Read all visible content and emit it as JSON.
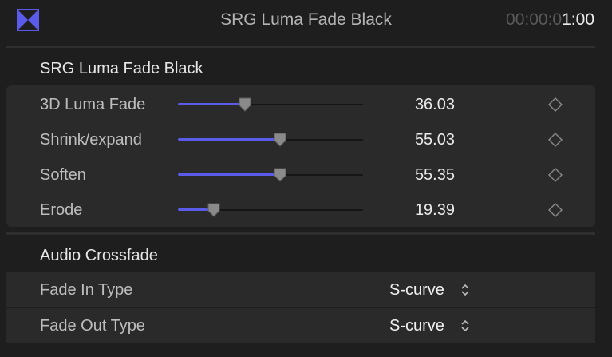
{
  "header": {
    "title": "SRG Luma Fade Black",
    "timecode_dim": "00:00:0",
    "timecode_bright": "1:00",
    "app_icon": "transition-bowtie-icon"
  },
  "colors": {
    "accent": "#5b5bea",
    "background": "#1e1e1e",
    "panel": "#2a2a2a"
  },
  "transition_section": {
    "title": "SRG Luma Fade Black",
    "params": [
      {
        "label": "3D Luma Fade",
        "value": "36.03",
        "fraction": 0.3603
      },
      {
        "label": "Shrink/expand",
        "value": "55.03",
        "fraction": 0.5503
      },
      {
        "label": "Soften",
        "value": "55.35",
        "fraction": 0.5535
      },
      {
        "label": "Erode",
        "value": "19.39",
        "fraction": 0.1939
      }
    ],
    "keyframe_icon": "keyframe-diamond-icon"
  },
  "audio_section": {
    "title": "Audio Crossfade",
    "rows": [
      {
        "label": "Fade In Type",
        "value": "S-curve"
      },
      {
        "label": "Fade Out Type",
        "value": "S-curve"
      }
    ]
  }
}
